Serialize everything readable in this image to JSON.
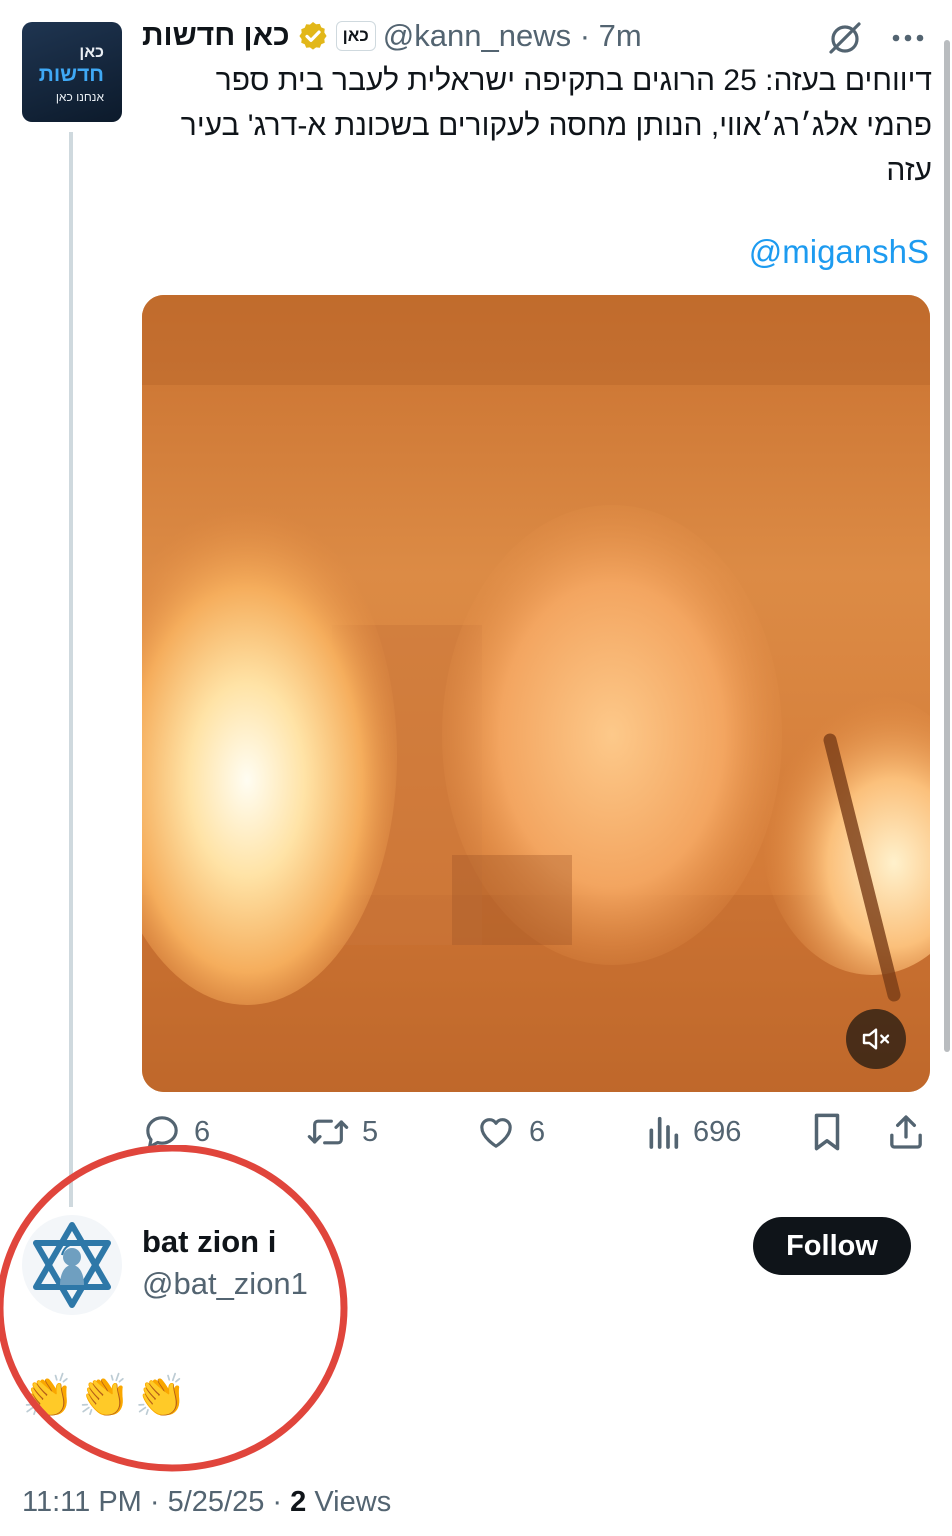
{
  "tweet": {
    "author": {
      "display_name": "כאן חדשות",
      "affiliate_badge": "כאן",
      "handle": "@kann_news",
      "time_ago": "7m",
      "avatar_lines": [
        "כאן",
        "חדשות",
        "אנחנו כאן"
      ]
    },
    "text": "דיווחים בעזה: 25 הרוגים בתקיפה ישראלית לעבר בית ספר פהמי אלג׳רג׳אווי, הנותן מחסה לעקורים בשכונת א-דרג' בעיר עזה",
    "mention": "@miganshS",
    "actions": {
      "replies": "6",
      "reposts": "5",
      "likes": "6",
      "views": "696"
    }
  },
  "reply": {
    "display_name": "bat zion i",
    "handle": "@bat_zion1",
    "follow_label": "Follow",
    "text": "👏👏👏",
    "time": "11:11 PM",
    "date": "5/25/25",
    "views_count": "2",
    "views_label": "Views"
  },
  "colors": {
    "link_blue": "#1d9bf0",
    "secondary_text": "#536471",
    "verified_gold": "#e2b719",
    "annotation_red": "#e0453c"
  },
  "icons": [
    "grok-icon",
    "more-icon",
    "verified-badge-icon",
    "mute-icon",
    "reply-icon",
    "repost-icon",
    "like-icon",
    "views-icon",
    "bookmark-icon",
    "share-icon"
  ]
}
